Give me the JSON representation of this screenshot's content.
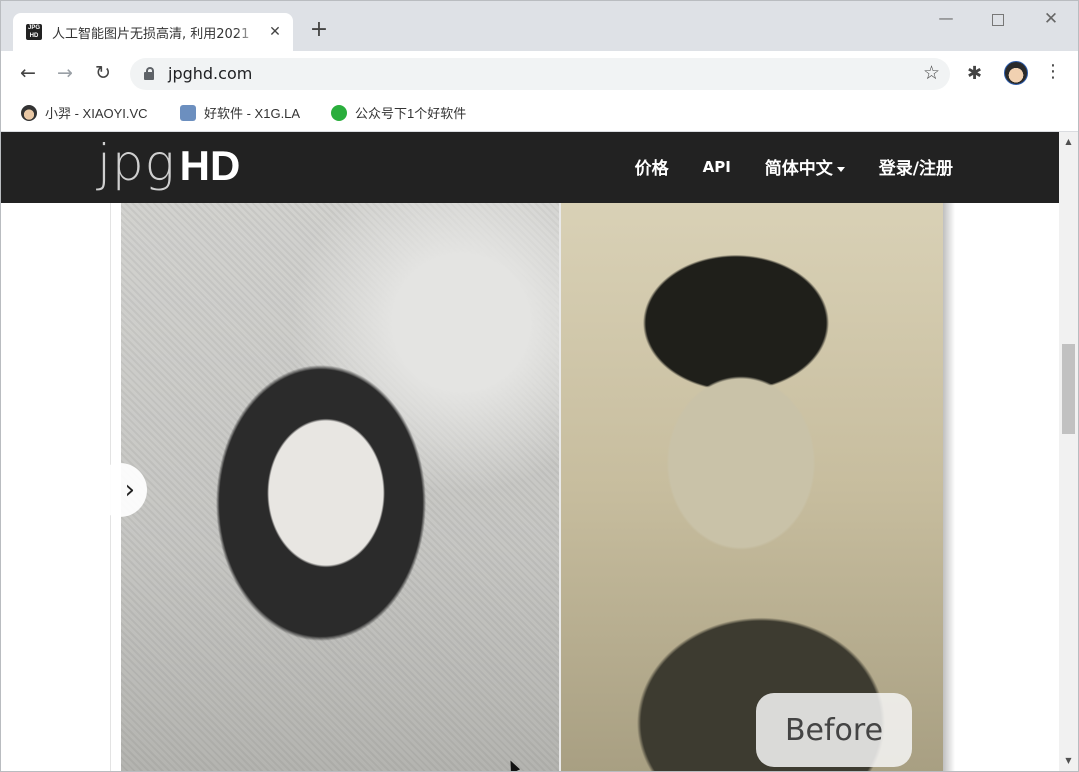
{
  "browser": {
    "tab": {
      "favicon": "JPG HD",
      "title": "人工智能图片无损高清, 利用2021",
      "close": "✕"
    },
    "new_tab": "+",
    "window": {
      "minimize": "—",
      "close": "✕"
    },
    "nav": {
      "back": "←",
      "forward": "→",
      "reload": "↻"
    },
    "url": "jpghd.com",
    "star": "☆",
    "extensions": "✱",
    "menu": "⋮"
  },
  "bookmarks": [
    {
      "label": "小羿 - XIAOYI.VC"
    },
    {
      "label": "好软件 - X1G.LA"
    },
    {
      "label": "公众号下1个好软件"
    }
  ],
  "site": {
    "logo": {
      "thin": "jpg",
      "bold": "HD"
    },
    "nav": {
      "price": "价格",
      "api": "API",
      "language": "简体中文",
      "login": "登录/注册"
    }
  },
  "slider": {
    "prev": "›",
    "badge": "Before"
  },
  "scrollbar": {
    "up": "▲",
    "down": "▼"
  }
}
